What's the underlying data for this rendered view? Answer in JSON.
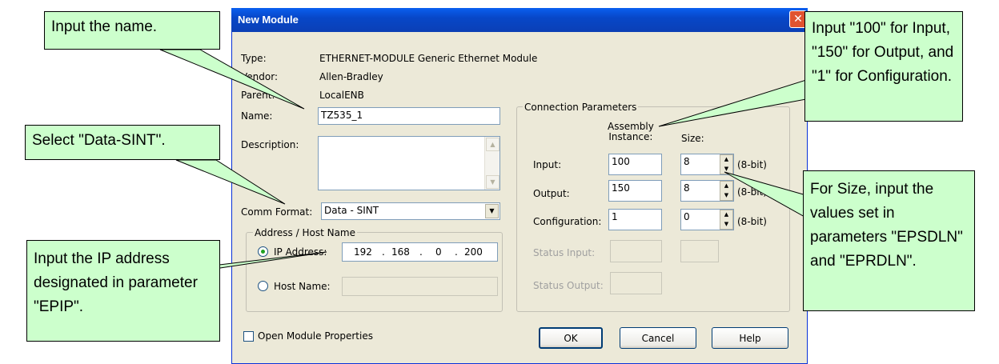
{
  "dialog": {
    "title": "New Module",
    "close_glyph": "✕",
    "type_label": "Type:",
    "type_value": "ETHERNET-MODULE Generic Ethernet Module",
    "vendor_label": "Vendor:",
    "vendor_value": "Allen-Bradley",
    "parent_label": "Parent:",
    "parent_value": "LocalENB",
    "name_label": "Name:",
    "name_value": "TZ535_1",
    "description_label": "Description:",
    "description_value": "",
    "comm_format_label": "Comm Format:",
    "comm_format_value": "Data - SINT",
    "address_group": {
      "title": "Address / Host Name",
      "ip_label": "IP Address:",
      "ip_octets": [
        "192",
        "168",
        "0",
        "200"
      ],
      "host_label": "Host Name:",
      "host_value": ""
    },
    "connection_group": {
      "title": "Connection Parameters",
      "col_assembly": "Assembly\nInstance:",
      "col_size": "Size:",
      "rows": [
        {
          "label": "Input:",
          "instance": "100",
          "size": "8",
          "unit": "(8-bit)"
        },
        {
          "label": "Output:",
          "instance": "150",
          "size": "8",
          "unit": "(8-bit)"
        },
        {
          "label": "Configuration:",
          "instance": "1",
          "size": "0",
          "unit": "(8-bit)"
        }
      ],
      "status_input_label": "Status Input:",
      "status_output_label": "Status Output:"
    },
    "open_props_label": "Open Module Properties",
    "ok_label": "OK",
    "cancel_label": "Cancel",
    "help_label": "Help"
  },
  "callouts": {
    "name": "Input the name.",
    "format": "Select \"Data-SINT\".",
    "ip": "Input the IP address designated in parameter \"EPIP\".",
    "assembly": "Input \"100\" for Input, \"150\" for Output, and \"1\" for Configuration.",
    "size": "For Size, input the values set in parameters \"EPSDLN\" and \"EPRDLN\"."
  },
  "colors": {
    "callout_bg": "#ccffcc",
    "titlebar": "#0a5ff0",
    "dialog_bg": "#ece9d8",
    "close_button": "#e0532f"
  }
}
